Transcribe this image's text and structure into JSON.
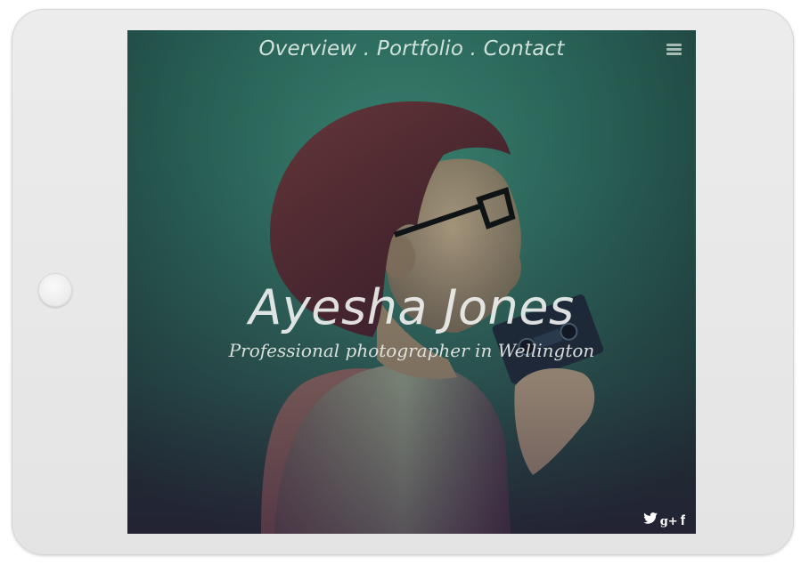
{
  "nav": {
    "overview": "Overview",
    "portfolio": "Portfolio",
    "contact": "Contact",
    "separator": " . "
  },
  "hero": {
    "title": "Ayesha Jones",
    "subtitle": "Professional photographer in Wellington"
  },
  "icons": {
    "menu": "hamburger-menu-icon",
    "twitter": "twitter-icon",
    "google_plus": "google-plus-icon",
    "facebook": "facebook-icon"
  },
  "social": {
    "google_plus_glyph": "g+",
    "facebook_glyph": "f"
  },
  "colors": {
    "background_teal": "#2e6e62",
    "text": "#e8ece8"
  }
}
